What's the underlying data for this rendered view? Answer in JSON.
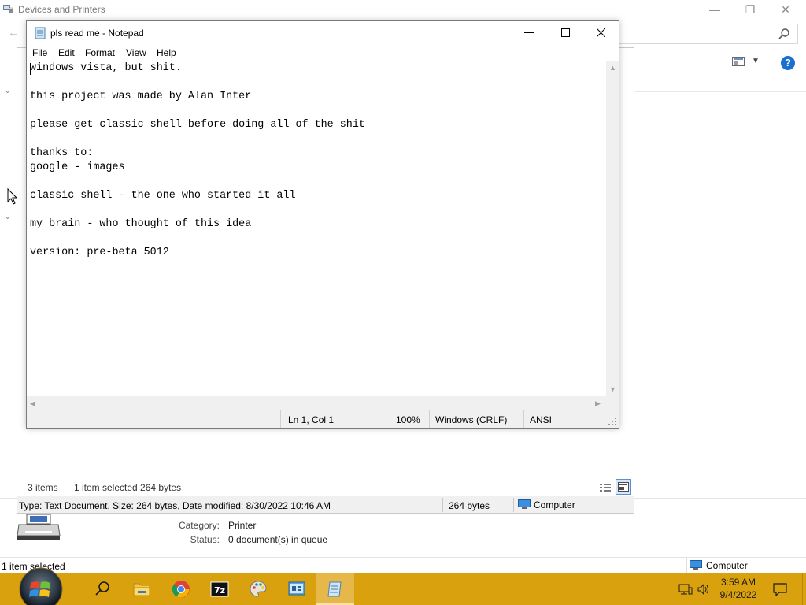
{
  "devices_window": {
    "title": "Devices and Printers",
    "back_glyph": "←",
    "minimize_glyph": "—",
    "maximize_glyph": "❐",
    "close_glyph": "✕",
    "help_glyph": "?",
    "view_caret": "▼",
    "details": {
      "category_label": "Category:",
      "category_value": "Printer",
      "status_label": "Status:",
      "status_value": "0 document(s) in queue"
    },
    "statusbar": {
      "left_text": "1 item selected",
      "location_text": "Computer"
    }
  },
  "explorer": {
    "status_items": "3 items",
    "status_selected": "1 item selected  264 bytes",
    "info_type": "Type: Text Document, Size: 264 bytes, Date modified: 8/30/2022 10:46 AM",
    "info_size": "264 bytes",
    "info_location": "Computer"
  },
  "notepad": {
    "title": "pls read me - Notepad",
    "menu": [
      "File",
      "Edit",
      "Format",
      "View",
      "Help"
    ],
    "lines": [
      "windows vista, but shit.",
      "",
      "this project was made by Alan Inter",
      "",
      "please get classic shell before doing all of the shit",
      "",
      "thanks to:",
      "google - images",
      "",
      "classic shell - the one who started it all",
      "",
      "my brain - who thought of this idea",
      "",
      "version: pre-beta 5012"
    ],
    "status": {
      "position": "Ln 1, Col 1",
      "zoom": "100%",
      "line_ending": "Windows (CRLF)",
      "encoding": "ANSI"
    }
  },
  "taskbar": {
    "apps": [
      "search",
      "file-explorer",
      "chrome",
      "7-zip",
      "paint",
      "control-panel",
      "notepad"
    ],
    "active_app": "notepad",
    "clock_time": "3:59 AM",
    "clock_date": "9/4/2022",
    "accent_color": "#d9a10d"
  },
  "colors": {
    "help_blue": "#1a6fd1",
    "selection_blue": "#1565c0"
  }
}
